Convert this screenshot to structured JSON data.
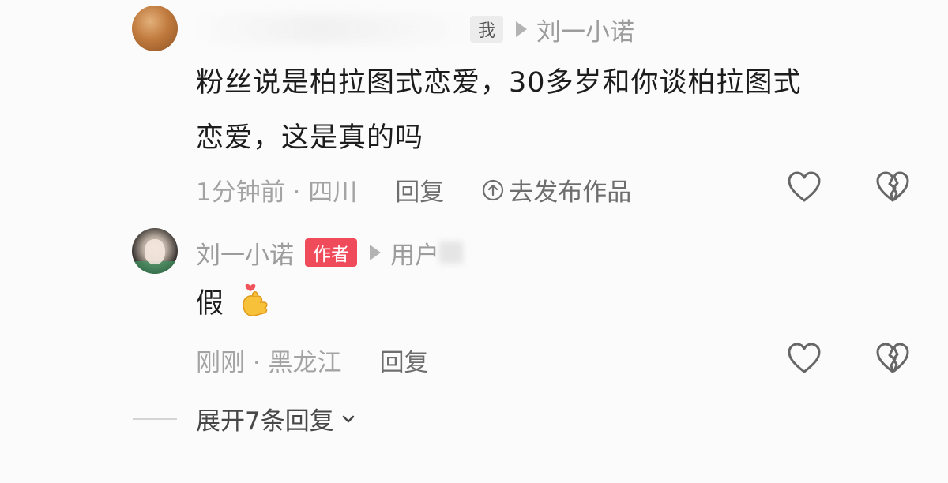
{
  "comment1": {
    "me_badge": "我",
    "reply_to": "刘一小诺",
    "text_line1": "粉丝说是柏拉图式恋爱，30多岁和你谈柏拉图式",
    "text_line2": "恋爱，这是真的吗",
    "time_location": "1分钟前 · 四川",
    "reply_label": "回复",
    "publish_label": "去发布作品"
  },
  "comment2": {
    "author_name": "刘一小诺",
    "author_badge": "作者",
    "reply_to": "用户",
    "text": "假",
    "time_location": "刚刚 · 黑龙江",
    "reply_label": "回复"
  },
  "expand": {
    "label": "展开7条回复"
  },
  "icons": {
    "like": "heart-outline-icon",
    "dislike": "broken-heart-icon",
    "publish": "circle-arrow-up-icon",
    "emoji": "finger-heart-emoji",
    "expand": "chevron-down-icon"
  },
  "colors": {
    "author_badge": "#f04b5b",
    "text": "#1c1c1c",
    "meta": "#9c9c9c"
  }
}
